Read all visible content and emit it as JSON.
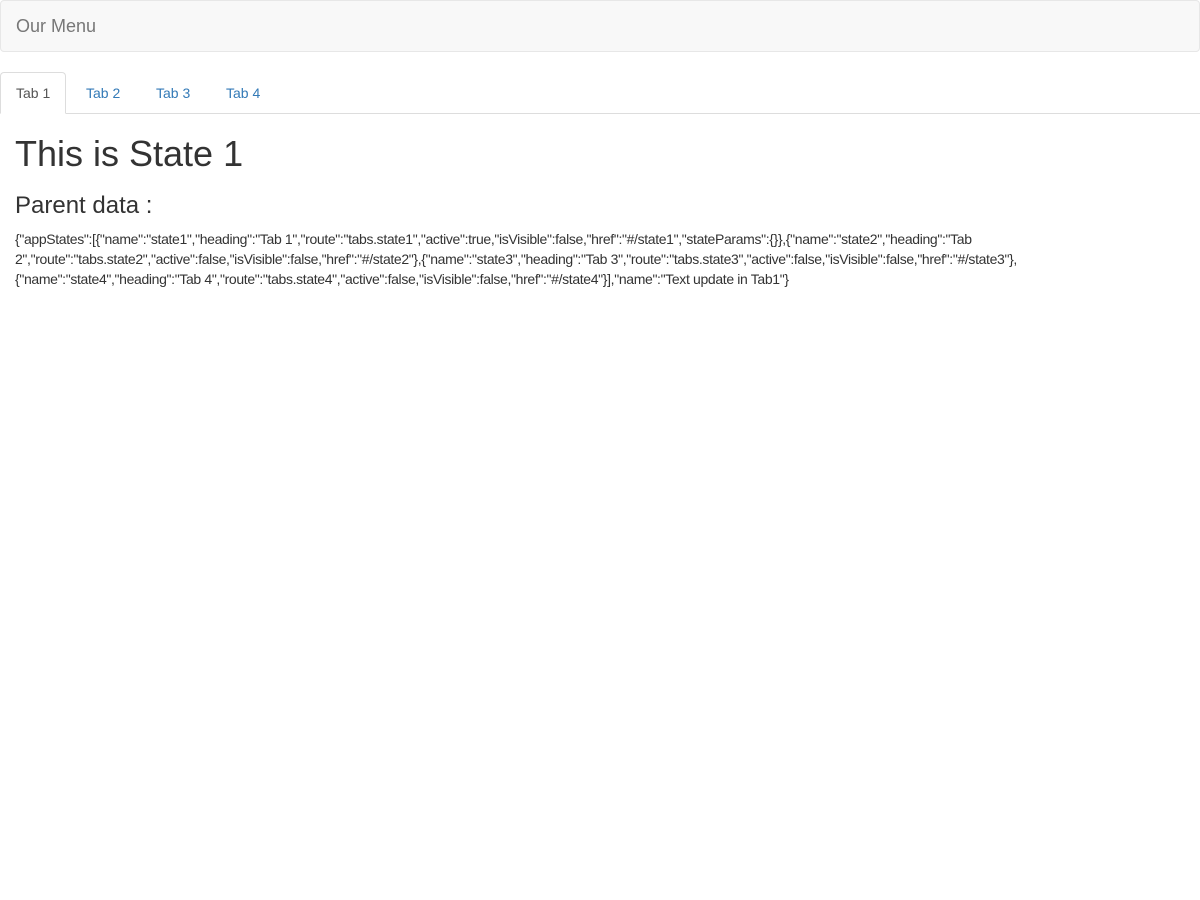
{
  "navbar": {
    "brand": "Our Menu"
  },
  "tabs": [
    {
      "label": "Tab 1",
      "active": true
    },
    {
      "label": "Tab 2",
      "active": false
    },
    {
      "label": "Tab 3",
      "active": false
    },
    {
      "label": "Tab 4",
      "active": false
    }
  ],
  "content": {
    "heading": "This is State 1",
    "parent_label": "Parent data :",
    "parent_json": "{\"appStates\":[{\"name\":\"state1\",\"heading\":\"Tab 1\",\"route\":\"tabs.state1\",\"active\":true,\"isVisible\":false,\"href\":\"#/state1\",\"stateParams\":{}},{\"name\":\"state2\",\"heading\":\"Tab 2\",\"route\":\"tabs.state2\",\"active\":false,\"isVisible\":false,\"href\":\"#/state2\"},{\"name\":\"state3\",\"heading\":\"Tab 3\",\"route\":\"tabs.state3\",\"active\":false,\"isVisible\":false,\"href\":\"#/state3\"},{\"name\":\"state4\",\"heading\":\"Tab 4\",\"route\":\"tabs.state4\",\"active\":false,\"isVisible\":false,\"href\":\"#/state4\"}],\"name\":\"Text update in Tab1\"}"
  }
}
